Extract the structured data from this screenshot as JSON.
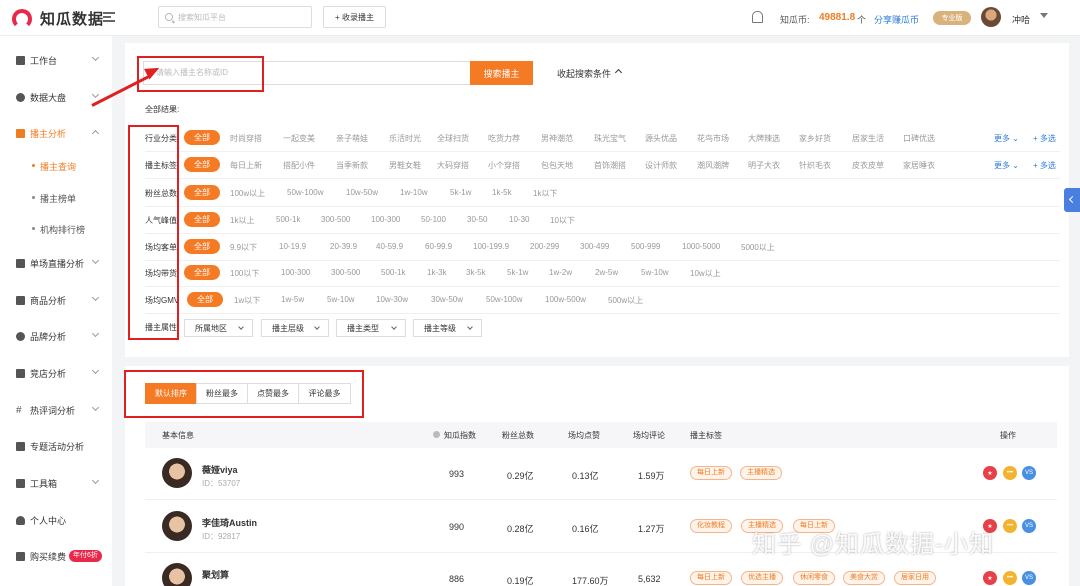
{
  "topbar": {
    "brand": "知瓜数据",
    "search_placeholder": "搜索知瓜平台",
    "collect_label": "+ 收录播主",
    "coin_label": "知瓜币:",
    "coin_value": "49881.8",
    "coin_unit": "个",
    "share_label": "分享赚瓜币",
    "plan_badge": "专业版",
    "user_name": "冲哈"
  },
  "sidebar": {
    "items": [
      {
        "label": "工作台",
        "icon": "grid-icon"
      },
      {
        "label": "数据大盘",
        "icon": "pie-icon"
      },
      {
        "label": "播主分析",
        "icon": "bar-chart-icon"
      },
      {
        "label": "单场直播分析",
        "icon": "live-icon"
      },
      {
        "label": "商品分析",
        "icon": "product-icon"
      },
      {
        "label": "品牌分析",
        "icon": "brand-icon"
      },
      {
        "label": "竞店分析",
        "icon": "store-icon"
      },
      {
        "label": "热评词分析",
        "icon": "hashtag-icon"
      },
      {
        "label": "专题活动分析",
        "icon": "topic-icon"
      },
      {
        "label": "工具箱",
        "icon": "toolbox-icon"
      },
      {
        "label": "个人中心",
        "icon": "user-icon"
      },
      {
        "label": "购买续费",
        "icon": "cart-icon"
      }
    ],
    "sub_items": [
      "播主查询",
      "播主榜单",
      "机构排行榜"
    ],
    "renew_badge": "年付6折"
  },
  "filters": {
    "search_placeholder": "请输入播主名称或ID",
    "search_button": "搜索播主",
    "collapse_label": "收起搜索条件",
    "all_results": "全部结果:",
    "all_label": "全部",
    "more_label": "更多",
    "multi_label": "+ 多选",
    "rows": [
      {
        "label": "行业分类",
        "options": [
          "时尚穿搭",
          "一起变美",
          "亲子萌娃",
          "乐活时光",
          "全球扫货",
          "吃货力荐",
          "男神潮范",
          "珠光宝气",
          "源头优品",
          "花鸟市场",
          "大牌辣选",
          "家乡好货",
          "居家生活",
          "口碑优选"
        ]
      },
      {
        "label": "播主标签",
        "options": [
          "每日上新",
          "搭配小件",
          "当季新款",
          "男鞋女鞋",
          "大码穿搭",
          "小个穿搭",
          "包包天地",
          "首饰潮搭",
          "设计师款",
          "潮风潮牌",
          "明子大衣",
          "针织毛衣",
          "皮衣皮草",
          "家居睡衣"
        ]
      },
      {
        "label": "粉丝总数",
        "options": [
          "100w以上",
          "50w-100w",
          "10w-50w",
          "1w-10w",
          "5k-1w",
          "1k-5k",
          "1k以下"
        ]
      },
      {
        "label": "人气峰值",
        "options": [
          "1k以上",
          "500-1k",
          "300-500",
          "100-300",
          "50-100",
          "30-50",
          "10-30",
          "10以下"
        ]
      },
      {
        "label": "场均客单",
        "options": [
          "9.9以下",
          "10-19.9",
          "20-39.9",
          "40-59.9",
          "60-99.9",
          "100-199.9",
          "200-299",
          "300-499",
          "500-999",
          "1000-5000",
          "5000以上"
        ]
      },
      {
        "label": "场均带货",
        "options": [
          "100以下",
          "100-300",
          "300-500",
          "500-1k",
          "1k-3k",
          "3k-5k",
          "5k-1w",
          "1w-2w",
          "2w-5w",
          "5w-10w",
          "10w以上"
        ]
      },
      {
        "label": "场均GMV",
        "options": [
          "1w以下",
          "1w-5w",
          "5w-10w",
          "10w-30w",
          "30w-50w",
          "50w-100w",
          "100w-500w",
          "500w以上"
        ]
      }
    ],
    "attr_label": "播主属性",
    "attr_dropdowns": [
      "所属地区",
      "播主层级",
      "播主类型",
      "播主等级"
    ]
  },
  "sort_tabs": [
    "默认排序",
    "粉丝最多",
    "点赞最多",
    "评论最多"
  ],
  "table": {
    "headers": [
      "基本信息",
      "知瓜指数",
      "粉丝总数",
      "场均点赞",
      "场均评论",
      "播主标签",
      "操作"
    ],
    "rows": [
      {
        "name": "薇娅viya",
        "id": "ID：53707",
        "index": "993",
        "fans": "0.29亿",
        "likes": "0.13亿",
        "comments": "1.59万",
        "tags": [
          "每日上新",
          "主播精选"
        ]
      },
      {
        "name": "李佳琦Austin",
        "id": "ID：92817",
        "index": "990",
        "fans": "0.28亿",
        "likes": "0.16亿",
        "comments": "1.27万",
        "tags": [
          "化妆教程",
          "主播精选",
          "每日上新"
        ]
      },
      {
        "name": "聚划算",
        "id": "",
        "index": "886",
        "fans": "0.19亿",
        "likes": "177.60万",
        "comments": "5,632",
        "tags": [
          "每日上新",
          "优选主播",
          "休闲零食",
          "美食大赏",
          "居家日用"
        ]
      }
    ],
    "op_icons": [
      "star-icon",
      "more-icon",
      "vs-icon"
    ],
    "op_vs_label": "VS"
  },
  "watermark": "知乎 @知瓜数据-小知",
  "colors": {
    "accent": "#f57a24",
    "brand": "#e8294b",
    "annotation": "#e02020",
    "link": "#2f7bd9"
  }
}
